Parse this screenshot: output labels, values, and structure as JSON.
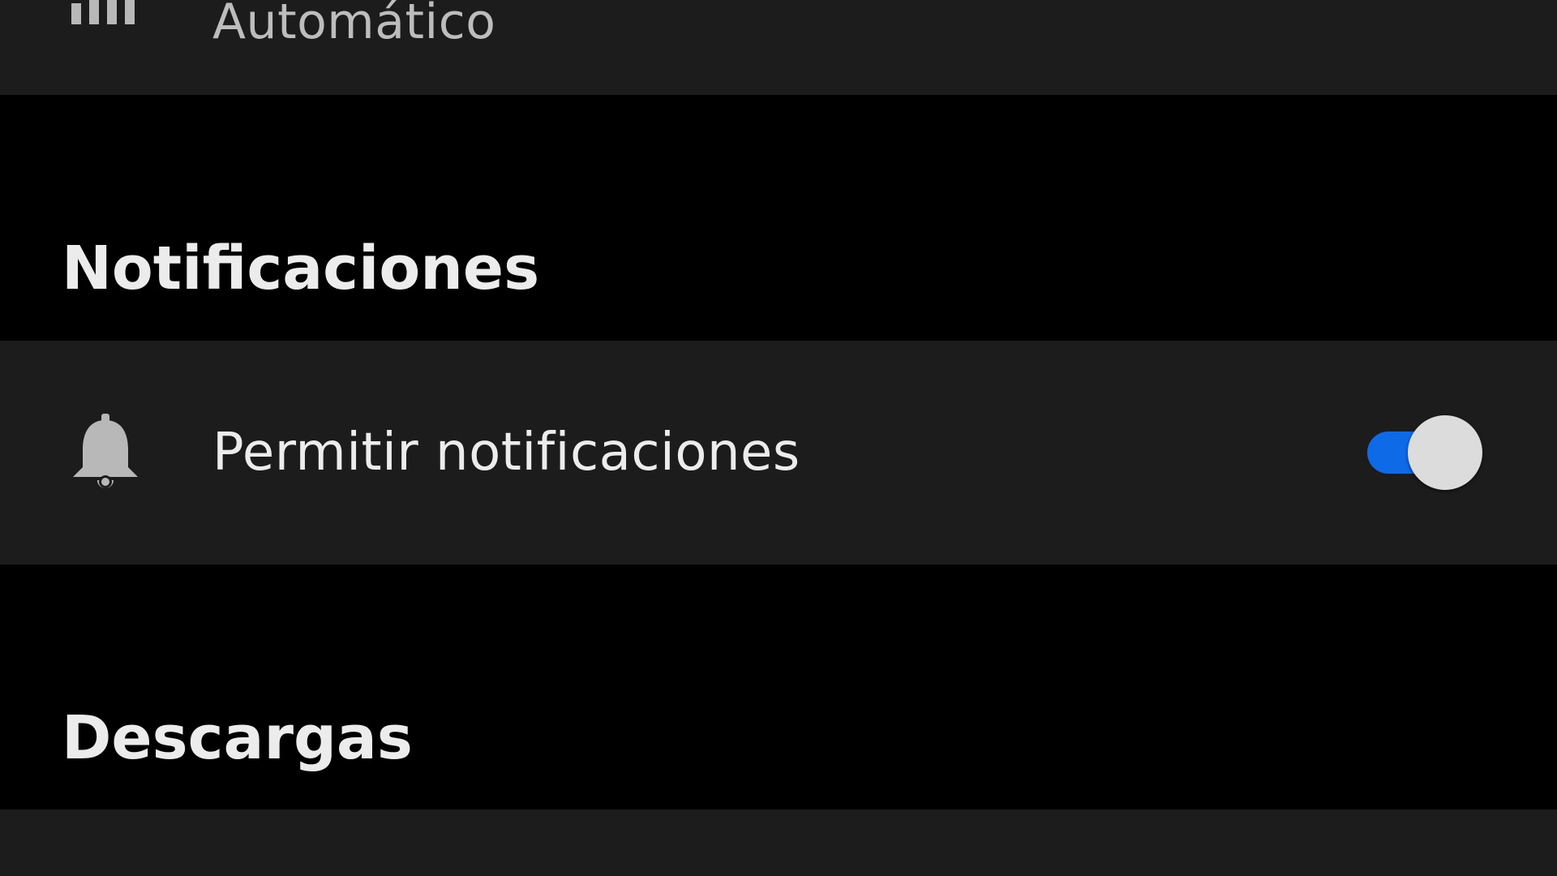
{
  "top_row": {
    "icon": "signal-bars-icon",
    "label": "Automático"
  },
  "sections": {
    "notifications": {
      "title": "Notificaciones",
      "item": {
        "icon": "bell-icon",
        "label": "Permitir notificaciones",
        "toggle_on": true
      }
    },
    "downloads": {
      "title": "Descargas"
    }
  },
  "colors": {
    "background": "#000000",
    "row_background": "#1c1c1c",
    "toggle_on": "#0f6ae8",
    "toggle_knob": "#dcdcdc",
    "icon": "#b8b8b8"
  }
}
